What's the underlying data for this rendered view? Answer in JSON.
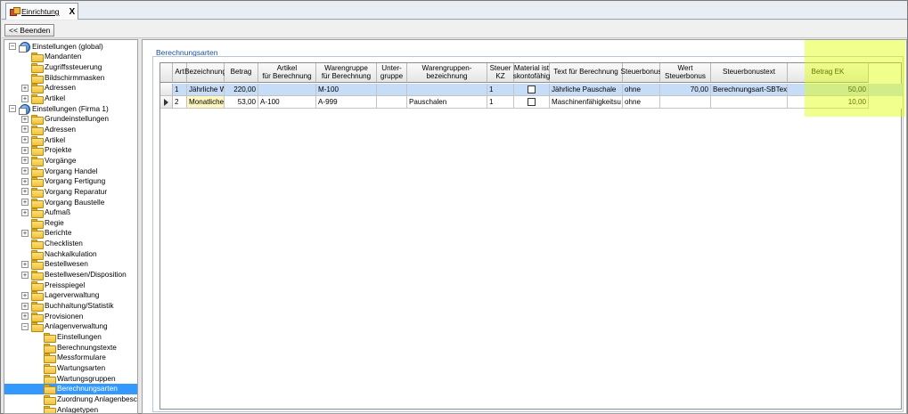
{
  "tab": {
    "label": "Einrichtung",
    "close": "X"
  },
  "toolbar": {
    "back_label": "<< Beenden"
  },
  "tree": [
    {
      "label": "Einstellungen (global)",
      "level": 0,
      "exp": "−",
      "icon": "globe"
    },
    {
      "label": "Mandanten",
      "level": 1,
      "exp": "",
      "icon": "folder"
    },
    {
      "label": "Zugriffssteuerung",
      "level": 1,
      "exp": "",
      "icon": "folder"
    },
    {
      "label": "Bildschirmmasken",
      "level": 1,
      "exp": "",
      "icon": "folder"
    },
    {
      "label": "Adressen",
      "level": 1,
      "exp": "+",
      "icon": "folder"
    },
    {
      "label": "Artikel",
      "level": 1,
      "exp": "+",
      "icon": "folder"
    },
    {
      "label": "Einstellungen (Firma 1)",
      "level": 0,
      "exp": "−",
      "icon": "globe"
    },
    {
      "label": "Grundeinstellungen",
      "level": 1,
      "exp": "+",
      "icon": "folder"
    },
    {
      "label": "Adressen",
      "level": 1,
      "exp": "+",
      "icon": "folder"
    },
    {
      "label": "Artikel",
      "level": 1,
      "exp": "+",
      "icon": "folder"
    },
    {
      "label": "Projekte",
      "level": 1,
      "exp": "+",
      "icon": "folder"
    },
    {
      "label": "Vorgänge",
      "level": 1,
      "exp": "+",
      "icon": "folder"
    },
    {
      "label": "Vorgang Handel",
      "level": 1,
      "exp": "+",
      "icon": "folder"
    },
    {
      "label": "Vorgang Fertigung",
      "level": 1,
      "exp": "+",
      "icon": "folder"
    },
    {
      "label": "Vorgang Reparatur",
      "level": 1,
      "exp": "+",
      "icon": "folder"
    },
    {
      "label": "Vorgang Baustelle",
      "level": 1,
      "exp": "+",
      "icon": "folder"
    },
    {
      "label": "Aufmaß",
      "level": 1,
      "exp": "+",
      "icon": "folder"
    },
    {
      "label": "Regie",
      "level": 1,
      "exp": "",
      "icon": "folder"
    },
    {
      "label": "Berichte",
      "level": 1,
      "exp": "+",
      "icon": "folder"
    },
    {
      "label": "Checklisten",
      "level": 1,
      "exp": "",
      "icon": "folder"
    },
    {
      "label": "Nachkalkulation",
      "level": 1,
      "exp": "",
      "icon": "folder"
    },
    {
      "label": "Bestellwesen",
      "level": 1,
      "exp": "+",
      "icon": "folder"
    },
    {
      "label": "Bestellwesen/Disposition",
      "level": 1,
      "exp": "+",
      "icon": "folder"
    },
    {
      "label": "Preisspiegel",
      "level": 1,
      "exp": "",
      "icon": "folder"
    },
    {
      "label": "Lagerverwaltung",
      "level": 1,
      "exp": "+",
      "icon": "folder"
    },
    {
      "label": "Buchhaltung/Statistik",
      "level": 1,
      "exp": "+",
      "icon": "folder"
    },
    {
      "label": "Provisionen",
      "level": 1,
      "exp": "+",
      "icon": "folder"
    },
    {
      "label": "Anlagenverwaltung",
      "level": 1,
      "exp": "−",
      "icon": "folder"
    },
    {
      "label": "Einstellungen",
      "level": 2,
      "exp": "",
      "icon": "folder"
    },
    {
      "label": "Berechnungstexte",
      "level": 2,
      "exp": "",
      "icon": "folder"
    },
    {
      "label": "Messformulare",
      "level": 2,
      "exp": "",
      "icon": "folder"
    },
    {
      "label": "Wartungsarten",
      "level": 2,
      "exp": "",
      "icon": "folder"
    },
    {
      "label": "Wartungsgruppen",
      "level": 2,
      "exp": "",
      "icon": "folder"
    },
    {
      "label": "Berechnungsarten",
      "level": 2,
      "exp": "",
      "icon": "folder",
      "selected": true
    },
    {
      "label": "Zuordnung Anlagenbeschr",
      "level": 2,
      "exp": "",
      "icon": "folder"
    },
    {
      "label": "Anlagetypen",
      "level": 2,
      "exp": "",
      "icon": "folder"
    }
  ],
  "panel": {
    "title": "Berechnungsarten"
  },
  "grid": {
    "columns": [
      "Art",
      "Bezeichnung",
      "Betrag",
      "Artikel\nfür Berechnung",
      "Warengruppe\nfür Berechnung",
      "Unter-\ngruppe",
      "Warengruppen-\nbezeichnung",
      "Steuer\nKZ",
      "Material ist\nskontofähig",
      "Text für Berechnung",
      "Steuerbonus",
      "Wert\nSteuerbonus",
      "Steuerbonustext",
      "Betrag EK"
    ],
    "rows": [
      [
        "1",
        "Jährliche Wartung",
        "220,00",
        "",
        "M-100",
        "",
        "",
        "1",
        false,
        "Jährliche Pauschale",
        "ohne",
        "70,00",
        "Berechnungsart-SBText",
        "50,00"
      ],
      [
        "2",
        "Monatlicher Test",
        "53,00",
        "A-100",
        "A-999",
        "",
        "Pauschalen",
        "1",
        false,
        "Maschinenfähigkeitsu",
        "ohne",
        "",
        "",
        "10,00"
      ]
    ]
  },
  "colors": {
    "highlight": "#e0ff00",
    "selection": "#3399ff",
    "row_selected": "#c7dcf6",
    "panel_title": "#1c4fa0"
  }
}
